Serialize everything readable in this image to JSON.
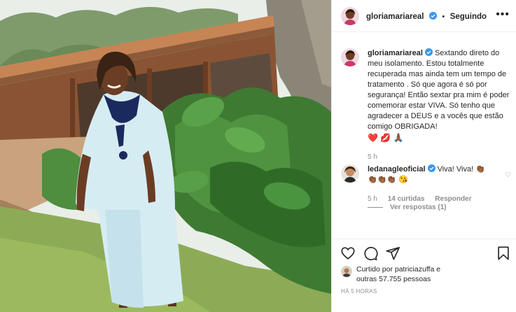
{
  "post": {
    "username": "gloriamariareal",
    "separator": "•",
    "follow_label": "Seguindo",
    "more_label": "•••"
  },
  "caption": {
    "username": "gloriamariareal",
    "text": "Sextando direto do meu isolamento. Estou totalmente recuperada mas ainda tem um tempo de tratamento . Só que agora é só por segurança! Então sextar pra mim é poder comemorar estar VIVA. Só tenho que agradecer a DEUS e a vocês que estão comigo OBRIGADA!",
    "emojis": "❤️ 💋 🙏🏾",
    "time": "5 h"
  },
  "comment": {
    "username": "ledanagleoficial",
    "text": "Viva! Viva! 👏🏾",
    "emojis": "👏🏾👏🏾👏🏾 😘",
    "time": "5 h",
    "likes": "14 curtidas",
    "reply_label": "Responder",
    "view_replies": "Ver respostas (1)",
    "heart": "♡"
  },
  "footer": {
    "liked_prefix": "Curtido por",
    "liked_user": "patriciazuffa",
    "liked_and": "e",
    "liked_others": "outras 57.755 pessoas",
    "time_ago": "HÁ 5 HORAS"
  },
  "icons": [
    "heart-icon",
    "comment-icon",
    "share-icon",
    "bookmark-icon",
    "verified-badge-icon",
    "more-options-icon"
  ],
  "colors": {
    "verified": "#3897f0",
    "text": "#262626",
    "muted": "#8e8e8e",
    "border": "#efefef"
  }
}
